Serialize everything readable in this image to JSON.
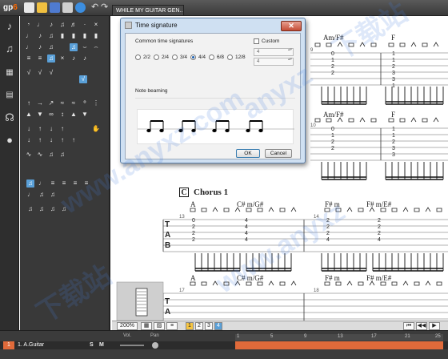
{
  "app": {
    "logo_prefix": "gp",
    "logo_suffix": "6"
  },
  "document_tab": "WHILE MY GUITAR GEN...",
  "dialog": {
    "title": "Time signature",
    "close": "✕",
    "common_label": "Common time signatures",
    "custom_label": "Custom",
    "options": [
      "2/2",
      "2/4",
      "3/4",
      "4/4",
      "6/8",
      "12/8"
    ],
    "selected_option": "4/4",
    "custom_numerator": "4",
    "custom_denominator": "4",
    "beaming_label": "Note beaming",
    "ok_label": "OK",
    "cancel_label": "Cancel"
  },
  "score": {
    "section_marker": "C",
    "section_title": "Chorus 1",
    "chords_row1": [
      "Am/F#",
      "F"
    ],
    "chords_row2": [
      "Am/F#",
      "F"
    ],
    "chords_chorus": [
      "A",
      "C# m/G#",
      "F# m",
      "F# m/E#"
    ],
    "chords_row4": [
      "A",
      "C# m/G#",
      "F# m",
      "F# m/E#"
    ],
    "bar_numbers": [
      "9",
      "10",
      "13",
      "14",
      "17",
      "18"
    ],
    "tab_letters": [
      "T",
      "A",
      "B"
    ],
    "fret_col1": [
      "0",
      "1",
      "2",
      "2"
    ],
    "fret_col2": [
      "1",
      "1",
      "2",
      "3",
      "3",
      "1"
    ],
    "fret_col3": [
      "0",
      "1",
      "2",
      "2"
    ],
    "fret_col4": [
      "1",
      "1",
      "2",
      "3",
      "3"
    ],
    "chorus_fret_a": [
      "0",
      "2",
      "2",
      "2"
    ],
    "chorus_fret_b": [
      "4",
      "4",
      "4",
      "4"
    ],
    "chorus_fret_c": [
      "2",
      "2",
      "2",
      "4"
    ],
    "chorus_fret_d": [
      "2",
      "2",
      "2",
      "4"
    ]
  },
  "controls": {
    "zoom": "200%",
    "pages": [
      "1",
      "2",
      "3",
      "4"
    ],
    "vol_label": "Vol.",
    "pan_label": "Pan"
  },
  "track": {
    "solo_label": "S",
    "mute_label": "M",
    "number": "1",
    "name": "1. A.Guitar",
    "ruler": [
      "1",
      "5",
      "9",
      "13",
      "17",
      "21",
      "25"
    ]
  },
  "watermarks": [
    "www.anyxz.com",
    "anyxz",
    "下载站",
    "下载站",
    "www.anyxz"
  ],
  "colors": {
    "accent": "#5aa0d8",
    "track_bar": "#e06a3a",
    "dialog_frame": "#cfe0f2"
  }
}
